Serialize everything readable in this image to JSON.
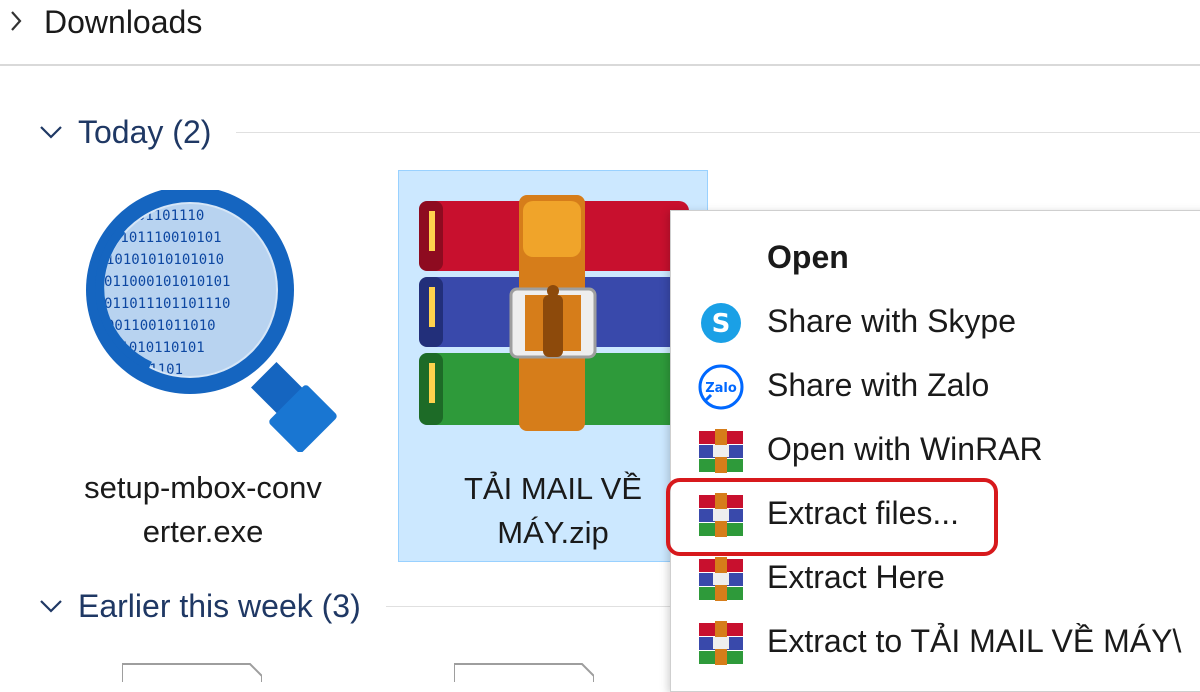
{
  "breadcrumb": {
    "title": "Downloads"
  },
  "groups": [
    {
      "label": "Today (2)"
    },
    {
      "label": "Earlier this week (3)"
    }
  ],
  "files": [
    {
      "name_line1": "setup-mbox-conv",
      "name_line2": "erter.exe",
      "icon": "magnifier-binary-icon"
    },
    {
      "name_line1": "TẢI MAIL VỀ",
      "name_line2": "MÁY.zip",
      "icon": "winrar-archive-icon"
    }
  ],
  "context_menu": {
    "items": [
      {
        "label": "Open",
        "icon": "none"
      },
      {
        "label": "Share with Skype",
        "icon": "skype-icon"
      },
      {
        "label": "Share with Zalo",
        "icon": "zalo-icon"
      },
      {
        "label": "Open with WinRAR",
        "icon": "winrar-icon"
      },
      {
        "label": "Extract files...",
        "icon": "winrar-icon"
      },
      {
        "label": "Extract Here",
        "icon": "winrar-icon"
      },
      {
        "label": "Extract to TẢI MAIL VỀ MÁY\\",
        "icon": "winrar-icon"
      }
    ],
    "highlighted": "Extract files..."
  },
  "colors": {
    "selection_bg": "#cce8ff",
    "group_label": "#1f3864",
    "highlight_ring": "#d7191c",
    "skype": "#1aa0e6",
    "zalo": "#0068ff"
  }
}
